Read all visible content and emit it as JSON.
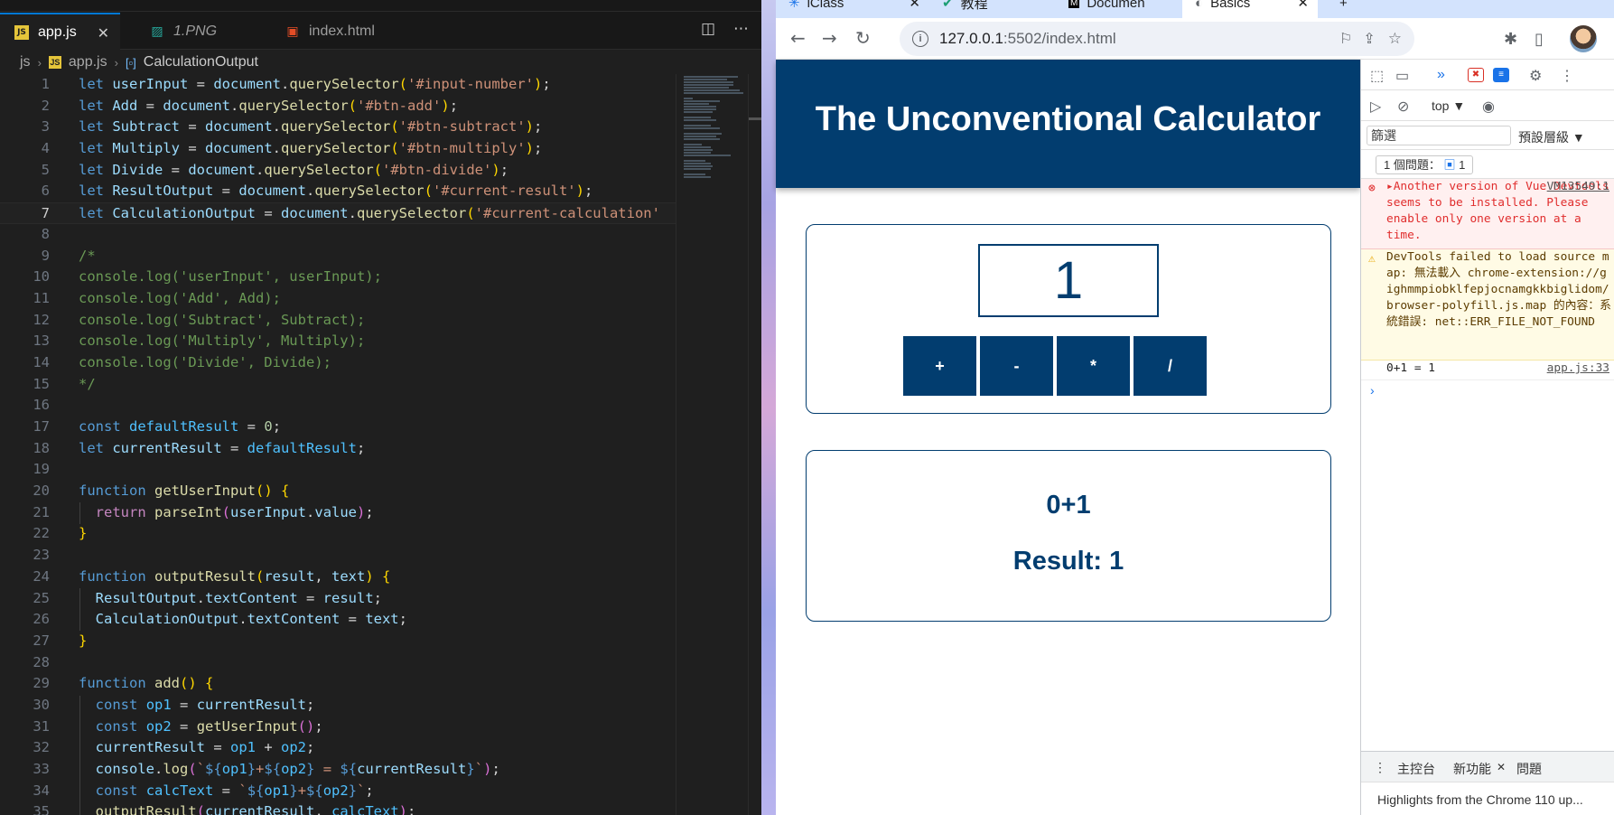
{
  "editor": {
    "tabs": [
      {
        "label": "app.js",
        "icon": "js-file-icon"
      },
      {
        "label": "1.PNG",
        "icon": "image-file-icon"
      },
      {
        "label": "index.html",
        "icon": "html-file-icon"
      }
    ],
    "breadcrumb": {
      "folder": "js",
      "file": "app.js",
      "symbol": "CalculationOutput"
    },
    "current_line": 7
  },
  "browser": {
    "tabs": [
      "iClass",
      "教程",
      "Documen",
      "Basics"
    ],
    "url_host": "127.0.0.1",
    "url_rest": ":5502/index.html"
  },
  "page": {
    "title": "The Unconventional Calculator",
    "input_value": "1",
    "buttons": {
      "add": "+",
      "subtract": "-",
      "multiply": "*",
      "divide": "/"
    },
    "current_calculation": "0+1",
    "result_label": "Result: ",
    "result_value": "1"
  },
  "devtools": {
    "context": "top ▼",
    "filter_placeholder": "篩選",
    "levels": "預設層級 ▼",
    "issues": "1 個問題：",
    "issues_count": "1",
    "error_text": "▸Another version of Vue Devtools seems to be installed. Please enable only one version at a time.",
    "error_link": "VM13549:1",
    "warning_text": "DevTools failed to load source map: 無法載入 chrome-extension://gighmmpiobklfepjocnamgkkbiglidom/browser-polyfill.js.map 的內容：系統錯誤: net::ERR_FILE_NOT_FOUND",
    "log_text": "0+1 = 1",
    "log_link": "app.js:33",
    "drawer_tabs": [
      "主控台",
      "新功能",
      "問題"
    ],
    "drawer_content": "Highlights from the Chrome 110 up..."
  }
}
